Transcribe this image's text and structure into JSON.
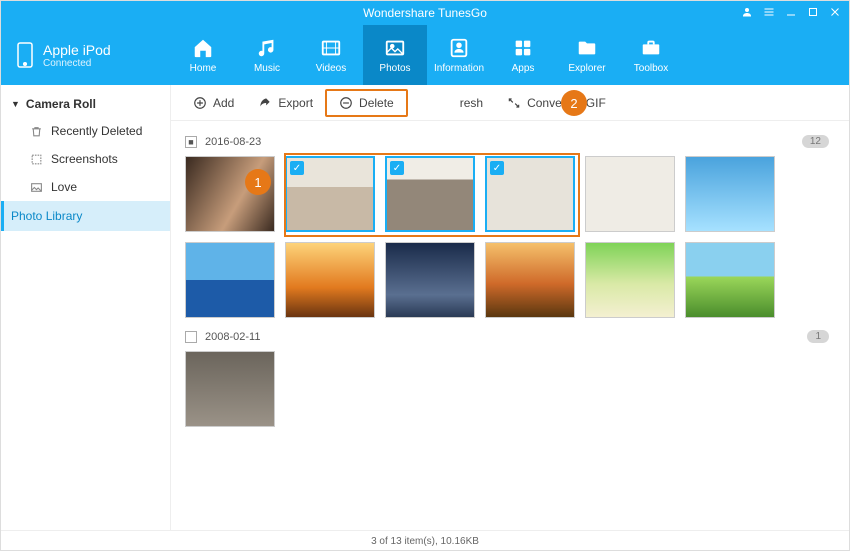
{
  "app_title": "Wondershare TunesGo",
  "device": {
    "name": "Apple  iPod",
    "status": "Connected"
  },
  "nav": [
    {
      "label": "Home"
    },
    {
      "label": "Music"
    },
    {
      "label": "Videos"
    },
    {
      "label": "Photos"
    },
    {
      "label": "Information"
    },
    {
      "label": "Apps"
    },
    {
      "label": "Explorer"
    },
    {
      "label": "Toolbox"
    }
  ],
  "sidebar": {
    "category": "Camera Roll",
    "items": [
      {
        "label": "Recently Deleted"
      },
      {
        "label": "Screenshots"
      },
      {
        "label": "Love"
      }
    ],
    "root": "Photo Library"
  },
  "toolbar": {
    "add": "Add",
    "export": "Export",
    "delete": "Delete",
    "refresh": "resh",
    "convert": "Convert to GIF"
  },
  "callouts": {
    "one": "1",
    "two": "2"
  },
  "sections": [
    {
      "date": "2016-08-23",
      "count": "12",
      "indeterminate": true,
      "thumbs": [
        {
          "selected": false,
          "cls": "img-portrait1"
        },
        {
          "selected": true,
          "cls": "img-portrait2"
        },
        {
          "selected": true,
          "cls": "img-portrait3"
        },
        {
          "selected": true,
          "cls": "img-puppy1"
        },
        {
          "selected": false,
          "cls": "img-puppy2"
        },
        {
          "selected": false,
          "cls": "img-penguins"
        },
        {
          "selected": false,
          "cls": "img-sky1"
        },
        {
          "selected": false,
          "cls": "img-sunset"
        },
        {
          "selected": false,
          "cls": "img-dusk"
        },
        {
          "selected": false,
          "cls": "img-sunset2"
        },
        {
          "selected": false,
          "cls": "img-garden"
        },
        {
          "selected": false,
          "cls": "img-field"
        }
      ]
    },
    {
      "date": "2008-02-11",
      "count": "1",
      "indeterminate": false,
      "thumbs": [
        {
          "selected": false,
          "cls": "img-koala"
        }
      ]
    }
  ],
  "statusbar": "3 of 13 item(s), 10.16KB"
}
